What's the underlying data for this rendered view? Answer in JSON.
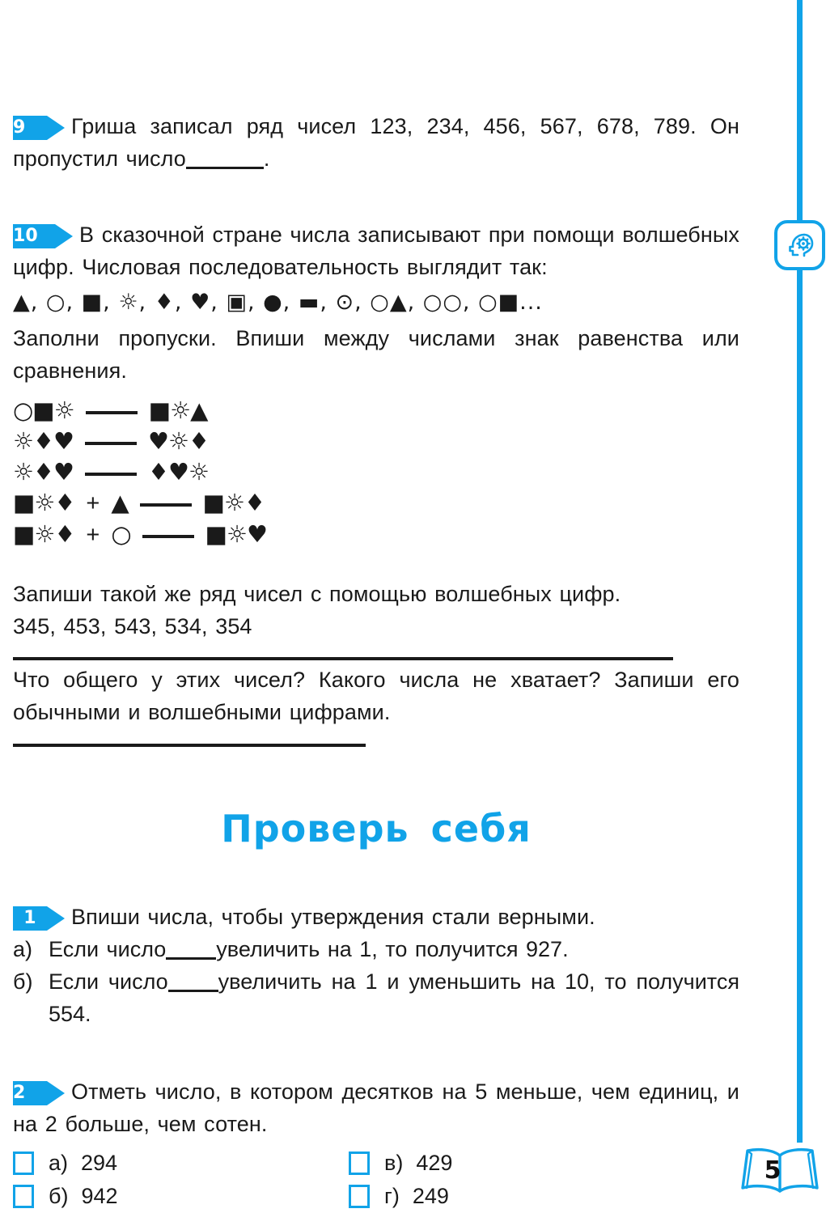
{
  "page": {
    "number": "5",
    "accent_color": "#11a3e8",
    "text_color": "#1a1a1a",
    "book_icon": "open-book-icon",
    "margin_icon": "head-with-gear-icon"
  },
  "tasks": [
    {
      "number": "9",
      "text_parts": {
        "before_blank": "Гриша  записал  ряд  чисел  123,  234,  456,  567,  678, 789.  Он  пропустил  число",
        "after_blank": "."
      }
    },
    {
      "number": "10",
      "intro": "В  сказочной  стране  числа  записывают  при  помощи  волшебных  цифр.  Числовая  последовательность  выглядит  так:",
      "sequence": "▲,  ○,  ■,  ☼,  ♦,  ♥,  ▣,  ●,  ▬,  ⊙,  ○▲,  ○○,  ○■...",
      "instruction": "Заполни  пропуски.  Впиши  между  числами  знак  равенства или   сравнения.",
      "comparisons": [
        {
          "left": "○■☼",
          "op": "",
          "mid": "",
          "right": "■☼▲"
        },
        {
          "left": "☼♦♥",
          "op": "",
          "mid": "",
          "right": "♥☼♦"
        },
        {
          "left": "☼♦♥",
          "op": "",
          "mid": "",
          "right": "♦♥☼"
        },
        {
          "left": "■☼♦",
          "op": "+",
          "mid": "▲",
          "right": "■☼♦"
        },
        {
          "left": "■☼♦",
          "op": "+",
          "mid": "○",
          "right": "■☼♥"
        }
      ],
      "write_series_prompt": "Запиши  такой  же  ряд  чисел  с  помощью  волшебных  цифр.",
      "series_numbers": "345,  453,  543,  534,  354",
      "question": "Что  общего  у  этих  чисел?  Какого  числа  не  хватает?  Запиши  его  обычными  и  волшебными  цифрами."
    }
  ],
  "self_check": {
    "heading": "Проверь  себя",
    "tasks": [
      {
        "number": "1",
        "prompt": "Впиши  числа,  чтобы  утверждения  стали  верными.",
        "items": [
          {
            "label": "а)",
            "before_blank": "Если  число",
            "after_blank": "увеличить  на  1,  то  получится  927."
          },
          {
            "label": "б)",
            "before_blank": "Если  число",
            "after_blank": "увеличить  на  1  и  уменьшить  на  10,  то  получится  554."
          }
        ]
      },
      {
        "number": "2",
        "prompt": "Отметь  число,  в  котором  десятков  на  5  меньше,  чем единиц,  и  на  2  больше,  чем  сотен.",
        "options": [
          {
            "label": "а)",
            "value": "294"
          },
          {
            "label": "в)",
            "value": "429"
          },
          {
            "label": "б)",
            "value": "942"
          },
          {
            "label": "г)",
            "value": "249"
          }
        ]
      }
    ]
  }
}
